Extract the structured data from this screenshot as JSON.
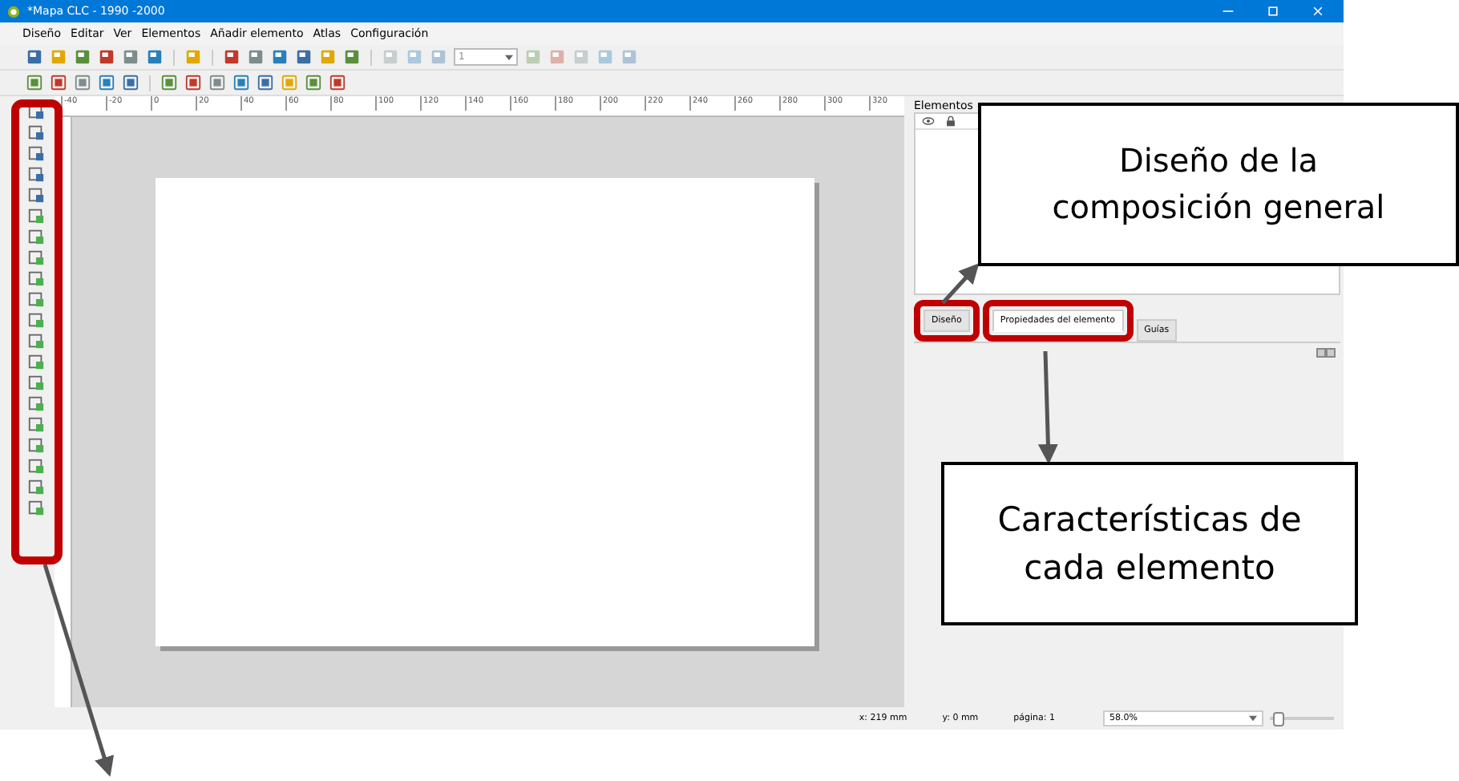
{
  "window": {
    "title": "*Mapa CLC - 1990 -2000"
  },
  "menu": [
    "Diseño",
    "Editar",
    "Ver",
    "Elementos",
    "Añadir elemento",
    "Atlas",
    "Configuración"
  ],
  "toolbar": {
    "page_field": "1"
  },
  "ruler": [
    "-40",
    "-20",
    "0",
    "20",
    "40",
    "60",
    "80",
    "100",
    "120",
    "140",
    "160",
    "180",
    "200",
    "220",
    "240",
    "260",
    "280",
    "300",
    "320"
  ],
  "panel": {
    "title": "Elementos"
  },
  "tabs": [
    {
      "label": "Diseño",
      "selected": false
    },
    {
      "label": "Propiedades del elemento",
      "selected": true
    },
    {
      "label": "Guías",
      "selected": false
    }
  ],
  "status_bar": {
    "x": "x: 219 mm",
    "y": "y: 0 mm",
    "page": "página: 1",
    "zoom": "58.0%",
    "zoom_slider": {
      "level": 0.05
    }
  },
  "callouts": [
    "Diseño de la composición general",
    "Características de cada elemento"
  ]
}
